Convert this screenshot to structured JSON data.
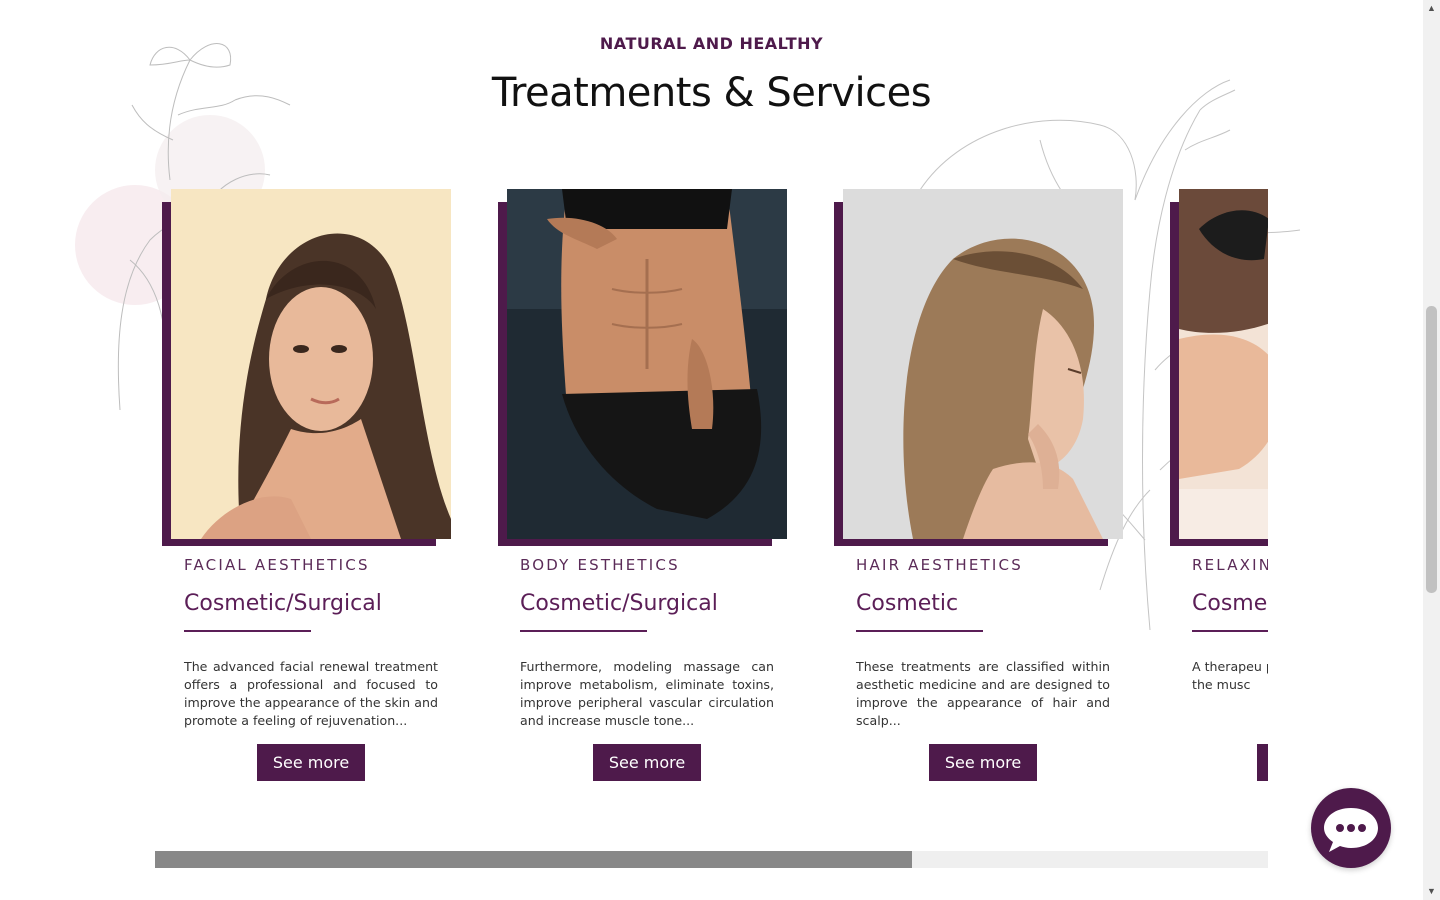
{
  "section": {
    "kicker": "NATURAL AND HEALTHY",
    "title": "Treatments & Services"
  },
  "colors": {
    "brand": "#4e1a4b",
    "accent_text": "#5b1e57",
    "progress_fill": "#888888",
    "progress_track": "#efefef"
  },
  "cards": [
    {
      "category": "FACIAL AESTHETICS",
      "subtitle": "Cosmetic/Surgical",
      "description": "The advanced facial renewal treatment offers a professional and focused to improve the appearance of the skin and promote a feeling of rejuvenation...",
      "button": "See more",
      "image": "woman-long-hair-portrait"
    },
    {
      "category": "BODY ESTHETICS",
      "subtitle": "Cosmetic/Surgical",
      "description": "Furthermore, modeling massage can improve metabolism, eliminate toxins, improve peripheral vascular circulation and increase muscle tone...",
      "button": "See more",
      "image": "toned-abdomen"
    },
    {
      "category": "HAIR AESTHETICS",
      "subtitle": "Cosmetic",
      "description": "These treatments are classified within aesthetic medicine and are designed to improve the appearance of hair and scalp...",
      "button": "See more",
      "image": "woman-profile-hair"
    },
    {
      "category": "RELAXIN",
      "subtitle": "Cosme",
      "description": "A therapeu promote rel applying ge to the musc",
      "button": "",
      "image": "massage-back"
    }
  ],
  "carousel": {
    "progress": 0.68
  },
  "chat": {
    "icon": "chat-bubble-icon"
  }
}
